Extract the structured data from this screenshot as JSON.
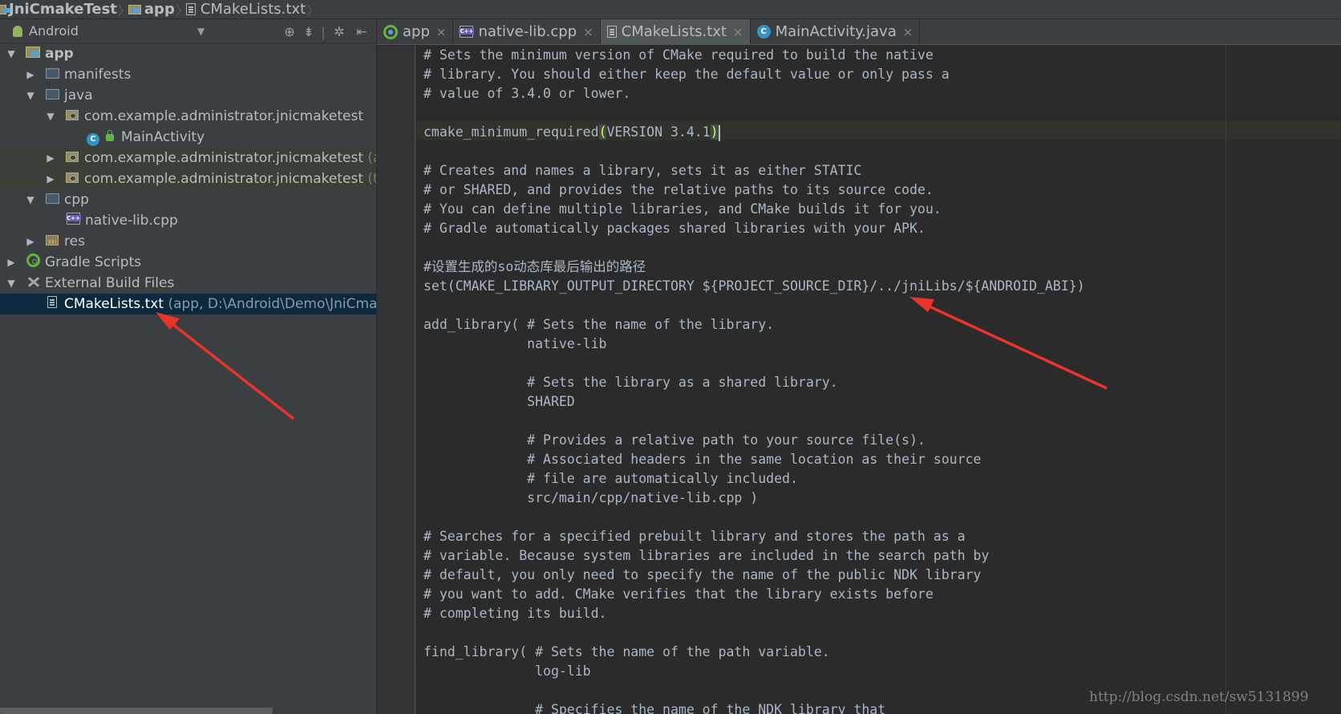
{
  "breadcrumb": [
    {
      "label": "JniCmakeTest",
      "icon": "folder-icon"
    },
    {
      "label": "app",
      "icon": "module-folder-icon"
    },
    {
      "label": "CMakeLists.txt",
      "icon": "text-file-icon"
    }
  ],
  "project_panel": {
    "view_mode": "Android",
    "tree": [
      {
        "label": "app",
        "hint": "",
        "depth": 0,
        "expanded": true,
        "icon": "module-folder-icon"
      },
      {
        "label": "manifests",
        "hint": "",
        "depth": 1,
        "expanded": false,
        "icon": "folder-icon"
      },
      {
        "label": "java",
        "hint": "",
        "depth": 1,
        "expanded": true,
        "icon": "folder-icon"
      },
      {
        "label": "com.example.administrator.jnicmaketest",
        "hint": "",
        "depth": 2,
        "expanded": true,
        "icon": "package-icon"
      },
      {
        "label": "MainActivity",
        "hint": "",
        "depth": 3,
        "expanded": null,
        "icon": "class-icon"
      },
      {
        "label": "com.example.administrator.jnicmaketest",
        "hint": "(andro",
        "depth": 2,
        "expanded": false,
        "icon": "package-icon"
      },
      {
        "label": "com.example.administrator.jnicmaketest",
        "hint": "(test)",
        "depth": 2,
        "expanded": false,
        "icon": "package-icon"
      },
      {
        "label": "cpp",
        "hint": "",
        "depth": 1,
        "expanded": true,
        "icon": "folder-icon"
      },
      {
        "label": "native-lib.cpp",
        "hint": "",
        "depth": 2,
        "expanded": null,
        "icon": "cpp-file-icon"
      },
      {
        "label": "res",
        "hint": "",
        "depth": 1,
        "expanded": false,
        "icon": "resource-folder-icon"
      },
      {
        "label": "Gradle Scripts",
        "hint": "",
        "depth": 0,
        "expanded": false,
        "icon": "gradle-icon"
      },
      {
        "label": "External Build Files",
        "hint": "",
        "depth": 0,
        "expanded": true,
        "icon": "wrench-icon"
      },
      {
        "label": "CMakeLists.txt",
        "hint": "(app, D:\\Android\\Demo\\JniCmakeTe",
        "depth": 1,
        "expanded": null,
        "icon": "text-file-icon",
        "selected": true
      }
    ]
  },
  "editor": {
    "tabs": [
      {
        "label": "app",
        "icon": "gradle-module-icon",
        "active": false
      },
      {
        "label": "native-lib.cpp",
        "icon": "cpp-file-icon",
        "active": false
      },
      {
        "label": "CMakeLists.txt",
        "icon": "text-file-icon",
        "active": true
      },
      {
        "label": "MainActivity.java",
        "icon": "class-icon",
        "active": false
      }
    ],
    "lines": [
      "# Sets the minimum version of CMake required to build the native",
      "# library. You should either keep the default value or only pass a",
      "# value of 3.4.0 or lower.",
      "",
      "cmake_minimum_required(VERSION 3.4.1)",
      "",
      "# Creates and names a library, sets it as either STATIC",
      "# or SHARED, and provides the relative paths to its source code.",
      "# You can define multiple libraries, and CMake builds it for you.",
      "# Gradle automatically packages shared libraries with your APK.",
      "",
      "#设置生成的so动态库最后输出的路径",
      "set(CMAKE_LIBRARY_OUTPUT_DIRECTORY ${PROJECT_SOURCE_DIR}/../jniLibs/${ANDROID_ABI})",
      "",
      "add_library( # Sets the name of the library.",
      "             native-lib",
      "",
      "             # Sets the library as a shared library.",
      "             SHARED",
      "",
      "             # Provides a relative path to your source file(s).",
      "             # Associated headers in the same location as their source",
      "             # file are automatically included.",
      "             src/main/cpp/native-lib.cpp )",
      "",
      "# Searches for a specified prebuilt library and stores the path as a",
      "# variable. Because system libraries are included in the search path by",
      "# default, you only need to specify the name of the public NDK library",
      "# you want to add. CMake verifies that the library exists before",
      "# completing its build.",
      "",
      "find_library( # Sets the name of the path variable.",
      "              log-lib",
      "",
      "              # Specifies the name of the NDK library that"
    ]
  },
  "watermark": "http://blog.csdn.net/sw5131899",
  "colors": {
    "annotation_arrow": "#e8342c",
    "selection": "#0d293e",
    "editor_bg": "#2b2b2b",
    "panel_bg": "#3c3f41",
    "bracket_highlight": "#ffef28"
  }
}
